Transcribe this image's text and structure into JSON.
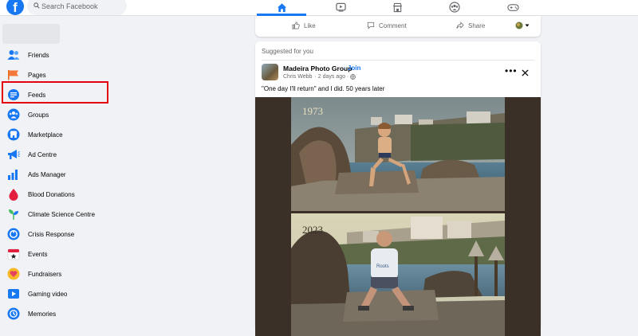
{
  "header": {
    "logo_letter": "f",
    "search_placeholder": "Search Facebook",
    "nav_icons": [
      "home-icon",
      "video-icon",
      "marketplace-icon",
      "groups-icon",
      "gaming-icon"
    ],
    "active_nav": "home-icon"
  },
  "sidebar": {
    "items": [
      {
        "label": "Friends",
        "icon": "friends-icon"
      },
      {
        "label": "Pages",
        "icon": "pages-flag-icon"
      },
      {
        "label": "Feeds",
        "icon": "feeds-icon"
      },
      {
        "label": "Groups",
        "icon": "groups-icon"
      },
      {
        "label": "Marketplace",
        "icon": "marketplace-icon"
      },
      {
        "label": "Ad Centre",
        "icon": "ad-centre-icon"
      },
      {
        "label": "Ads Manager",
        "icon": "ads-manager-icon"
      },
      {
        "label": "Blood Donations",
        "icon": "blood-drop-icon"
      },
      {
        "label": "Climate Science Centre",
        "icon": "climate-icon"
      },
      {
        "label": "Crisis Response",
        "icon": "crisis-response-icon"
      },
      {
        "label": "Events",
        "icon": "events-icon"
      },
      {
        "label": "Fundraisers",
        "icon": "fundraisers-icon"
      },
      {
        "label": "Gaming video",
        "icon": "gaming-video-icon"
      },
      {
        "label": "Memories",
        "icon": "memories-icon"
      }
    ],
    "highlighted_item": "Pages"
  },
  "action_bar": {
    "like": "Like",
    "comment": "Comment",
    "share": "Share"
  },
  "post": {
    "suggested_label": "Suggested for you",
    "group_name": "Madeira Photo Group",
    "join_label": "· Join",
    "author": "Chris Webb",
    "time": "· 2 days ago ·",
    "more": "•••",
    "caption": "\"One day I'll return\" and I did. 50 years later",
    "photo_year_top": "1973",
    "photo_year_bottom": "2023"
  },
  "colors": {
    "brand": "#1877f2",
    "highlight": "#e4000f",
    "background": "#f0f2f5"
  }
}
